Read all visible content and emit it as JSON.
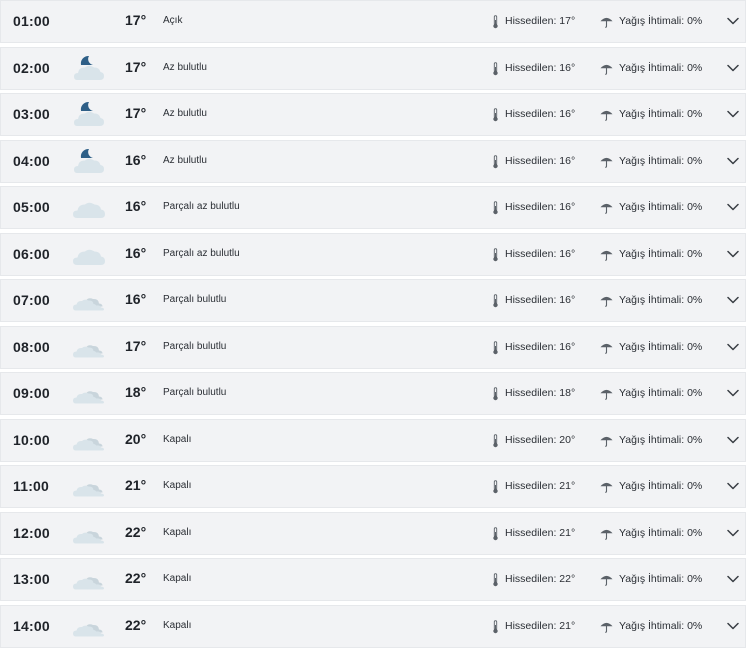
{
  "labels": {
    "feels_like": "Hissedilen:",
    "rain_chance": "Yağış İhtimali:"
  },
  "hours": [
    {
      "time": "01:00",
      "temp": "17°",
      "condition": "Açık",
      "feels": "17°",
      "rain": "0%",
      "icon": "moon-icon"
    },
    {
      "time": "02:00",
      "temp": "17°",
      "condition": "Az bulutlu",
      "feels": "16°",
      "rain": "0%",
      "icon": "moon-cloud-icon"
    },
    {
      "time": "03:00",
      "temp": "17°",
      "condition": "Az bulutlu",
      "feels": "16°",
      "rain": "0%",
      "icon": "moon-cloud-icon"
    },
    {
      "time": "04:00",
      "temp": "16°",
      "condition": "Az bulutlu",
      "feels": "16°",
      "rain": "0%",
      "icon": "moon-cloud-icon"
    },
    {
      "time": "05:00",
      "temp": "16°",
      "condition": "Parçalı az bulutlu",
      "feels": "16°",
      "rain": "0%",
      "icon": "cloud-icon"
    },
    {
      "time": "06:00",
      "temp": "16°",
      "condition": "Parçalı az bulutlu",
      "feels": "16°",
      "rain": "0%",
      "icon": "cloud-icon"
    },
    {
      "time": "07:00",
      "temp": "16°",
      "condition": "Parçalı bulutlu",
      "feels": "16°",
      "rain": "0%",
      "icon": "clouds-icon"
    },
    {
      "time": "08:00",
      "temp": "17°",
      "condition": "Parçalı bulutlu",
      "feels": "16°",
      "rain": "0%",
      "icon": "clouds-icon"
    },
    {
      "time": "09:00",
      "temp": "18°",
      "condition": "Parçalı bulutlu",
      "feels": "18°",
      "rain": "0%",
      "icon": "clouds-icon"
    },
    {
      "time": "10:00",
      "temp": "20°",
      "condition": "Kapalı",
      "feels": "20°",
      "rain": "0%",
      "icon": "clouds-icon"
    },
    {
      "time": "11:00",
      "temp": "21°",
      "condition": "Kapalı",
      "feels": "21°",
      "rain": "0%",
      "icon": "clouds-icon"
    },
    {
      "time": "12:00",
      "temp": "22°",
      "condition": "Kapalı",
      "feels": "21°",
      "rain": "0%",
      "icon": "clouds-icon"
    },
    {
      "time": "13:00",
      "temp": "22°",
      "condition": "Kapalı",
      "feels": "22°",
      "rain": "0%",
      "icon": "clouds-icon"
    },
    {
      "time": "14:00",
      "temp": "22°",
      "condition": "Kapalı",
      "feels": "21°",
      "rain": "0%",
      "icon": "clouds-icon"
    }
  ],
  "colors": {
    "moon": "#2e5f87",
    "cloud_light": "#d9e4ea",
    "cloud_mid": "#c9d5dc",
    "icon_gray": "#5b6168"
  }
}
